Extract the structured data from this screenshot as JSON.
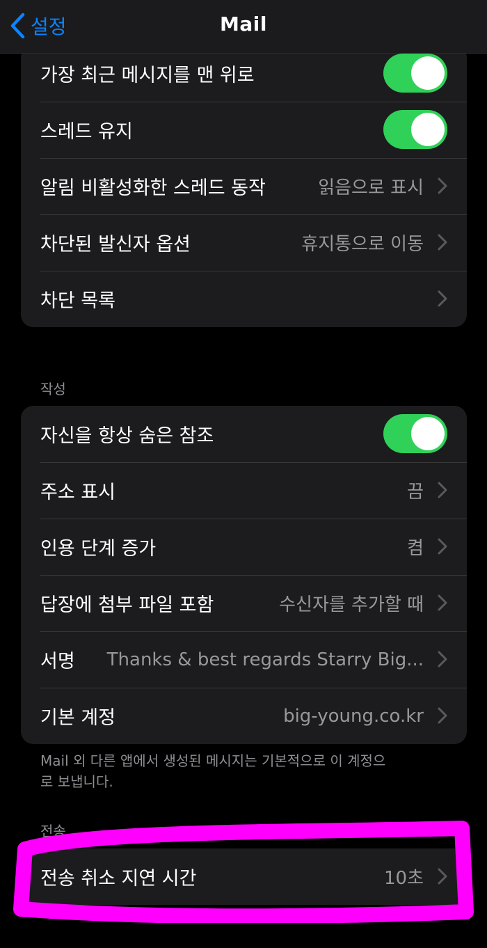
{
  "nav": {
    "back_label": "설정",
    "title": "Mail"
  },
  "group1": {
    "rows": [
      {
        "label": "가장 최근 메시지를 맨 위로",
        "toggle": true
      },
      {
        "label": "스레드 유지",
        "toggle": true
      },
      {
        "label": "알림 비활성화한 스레드 동작",
        "value": "읽음으로 표시"
      },
      {
        "label": "차단된 발신자 옵션",
        "value": "휴지통으로 이동"
      },
      {
        "label": "차단 목록"
      }
    ]
  },
  "compose": {
    "header": "작성",
    "rows": [
      {
        "label": "자신을 항상 숨은 참조",
        "toggle": true
      },
      {
        "label": "주소 표시",
        "value": "끔"
      },
      {
        "label": "인용 단계 증가",
        "value": "켬"
      },
      {
        "label": "답장에 첨부 파일 포함",
        "value": "수신자를 추가할 때"
      },
      {
        "label": "서명",
        "value": "Thanks & best regards Starry Big..."
      },
      {
        "label": "기본 계정",
        "value": "big-young.co.kr"
      }
    ],
    "footer": "Mail 외 다른 앱에서 생성된 메시지는 기본적으로 이 계정으로 보냅니다."
  },
  "send": {
    "header": "전송",
    "rows": [
      {
        "label": "전송 취소 지연 시간",
        "value": "10초"
      }
    ]
  },
  "colors": {
    "accent": "#0a84ff",
    "toggle_on": "#30d158",
    "highlight": "#ff00ff",
    "cell_bg": "#1c1c1e"
  }
}
